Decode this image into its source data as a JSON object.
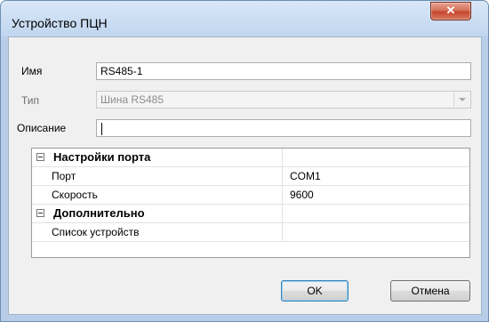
{
  "window": {
    "title": "Устройство ПЦН",
    "close_glyph": "✕"
  },
  "form": {
    "name_label": "Имя",
    "name_value": "RS485-1",
    "type_label": "Тип",
    "type_value": "Шина RS485",
    "description_label": "Описание",
    "description_value": ""
  },
  "grid": {
    "categories": [
      {
        "label": "Настройки порта",
        "properties": [
          {
            "name": "Порт",
            "value": "COM1"
          },
          {
            "name": "Скорость",
            "value": "9600"
          }
        ]
      },
      {
        "label": "Дополнительно",
        "properties": [
          {
            "name": "Список устройств",
            "value": ""
          }
        ]
      }
    ]
  },
  "buttons": {
    "ok": "OK",
    "cancel": "Отмена"
  }
}
